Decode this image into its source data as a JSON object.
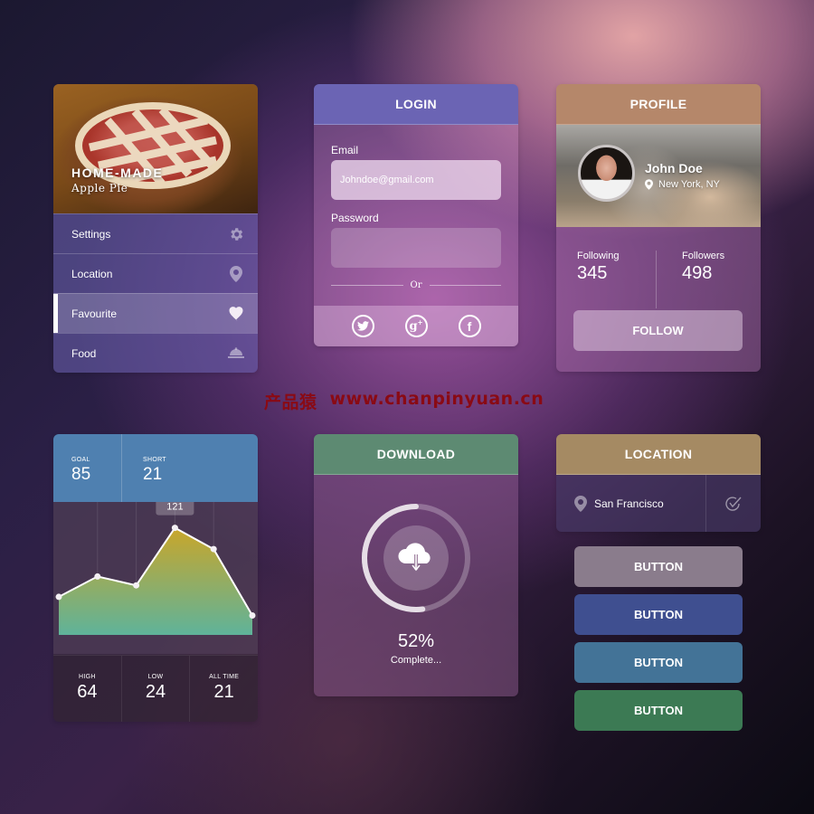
{
  "menu_card": {
    "hero_title": "HOME-MADE",
    "hero_subtitle": "Apple Pie",
    "items": [
      {
        "label": "Settings",
        "icon": "gear-icon",
        "active": false
      },
      {
        "label": "Location",
        "icon": "map-pin-icon",
        "active": false
      },
      {
        "label": "Favourite",
        "icon": "heart-icon",
        "active": true
      },
      {
        "label": "Food",
        "icon": "food-cloche-icon",
        "active": false
      }
    ]
  },
  "login_card": {
    "title": "LOGIN",
    "email_label": "Email",
    "email_value": "Johndoe@gmail.com",
    "password_label": "Password",
    "password_value": "",
    "or_label": "Or",
    "social": [
      "twitter-icon",
      "google-plus-icon",
      "facebook-icon"
    ]
  },
  "profile_card": {
    "title": "PROFILE",
    "name": "John Doe",
    "location": "New York, NY",
    "following_label": "Following",
    "following_value": "345",
    "followers_label": "Followers",
    "followers_value": "498",
    "follow_button": "FOLLOW"
  },
  "watermark": {
    "cn": "产品猿",
    "url": "www.chanpinyuan.cn",
    "color": "#8a0a14"
  },
  "chart_card": {
    "goal_label": "GOAL",
    "goal_value": "85",
    "short_label": "SHORT",
    "short_value": "21",
    "high_label": "HIGH",
    "high_value": "64",
    "low_label": "LOW",
    "low_value": "24",
    "alltime_label": "ALL TIME",
    "alltime_value": "21",
    "tooltip": "121"
  },
  "chart_data": {
    "type": "area",
    "title": "",
    "xlabel": "",
    "ylabel": "",
    "x": [
      1,
      2,
      3,
      4,
      5,
      6
    ],
    "values": [
      43,
      66,
      56,
      121,
      97,
      22
    ],
    "ylim": [
      0,
      140
    ],
    "highlight_index": 3,
    "highlight_label": "121",
    "grid": "vertical",
    "legend": "none",
    "fill_colors": [
      "#c9a62a",
      "#5fb39a"
    ],
    "line_color": "#ffffff"
  },
  "download_card": {
    "title": "DOWNLOAD",
    "progress_percent": 52,
    "progress_label": "52%",
    "status": "Complete..."
  },
  "location_card": {
    "title": "LOCATION",
    "city": "San Francisco"
  },
  "buttons": [
    {
      "label": "BUTTON",
      "color": "#8a7c8c"
    },
    {
      "label": "BUTTON",
      "color": "#3f4f90"
    },
    {
      "label": "BUTTON",
      "color": "#437397"
    },
    {
      "label": "BUTTON",
      "color": "#3c7a54"
    }
  ],
  "colors": {
    "login_header": "#6b64b4",
    "profile_header": "#b5876a",
    "chart_header": "#4f80b0",
    "download_header": "#5d8a72",
    "location_header": "#a58a63"
  }
}
